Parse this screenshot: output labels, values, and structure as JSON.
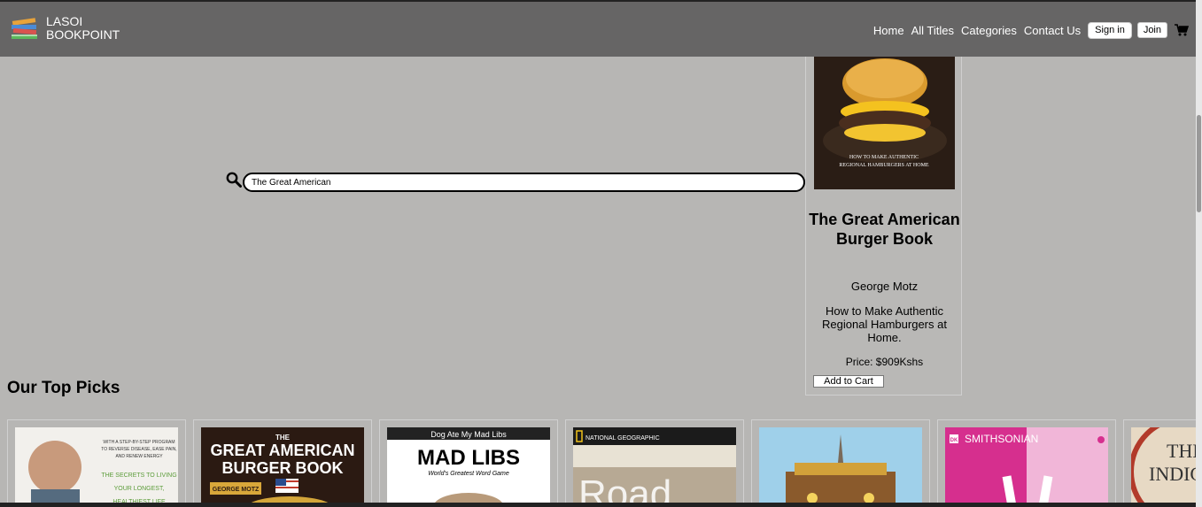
{
  "brand": {
    "line1": "LASOI",
    "line2": "BOOKPOINT"
  },
  "nav": {
    "home": "Home",
    "all_titles": "All Titles",
    "categories": "Categories",
    "contact": "Contact Us",
    "signin": "Sign in",
    "join": "Join"
  },
  "search": {
    "value": "The Great American "
  },
  "result": {
    "cover_text": "HOW TO MAKE AUTHENTIC REGIONAL HAMBURGERS AT HOME",
    "title": "The Great American Burger Book",
    "author": "George Motz",
    "description": "How to Make Authentic Regional Hamburgers at Home.",
    "price": "Price: $909Kshs",
    "add_to_cart": "Add to Cart"
  },
  "top_picks": {
    "heading": "Our Top Picks",
    "covers": [
      {
        "lines": [
          "WITH A STEP-BY-STEP PROGRAM",
          "TO REVERSE DISEASE, EASE PAIN,",
          "AND RENEW ENERGY",
          "THE SECRETS TO LIVING",
          "YOUR LONGEST,",
          "HEALTHIEST LIFE"
        ]
      },
      {
        "lines": [
          "THE",
          "GREAT AMERICAN",
          "BURGER BOOK",
          "GEORGE MOTZ"
        ]
      },
      {
        "lines": [
          "Dog Ate My Mad Libs",
          "MAD LIBS",
          "World's Greatest Word Game"
        ]
      },
      {
        "lines": [
          "NATIONAL GEOGRAPHIC",
          "Road"
        ]
      },
      {
        "lines": []
      },
      {
        "lines": [
          "DK",
          "SMITHSONIAN"
        ]
      },
      {
        "lines": [
          "THE",
          "INDIG"
        ]
      }
    ]
  },
  "colors": {
    "topbar": "#666565",
    "page_bg": "#b7b6b4"
  }
}
